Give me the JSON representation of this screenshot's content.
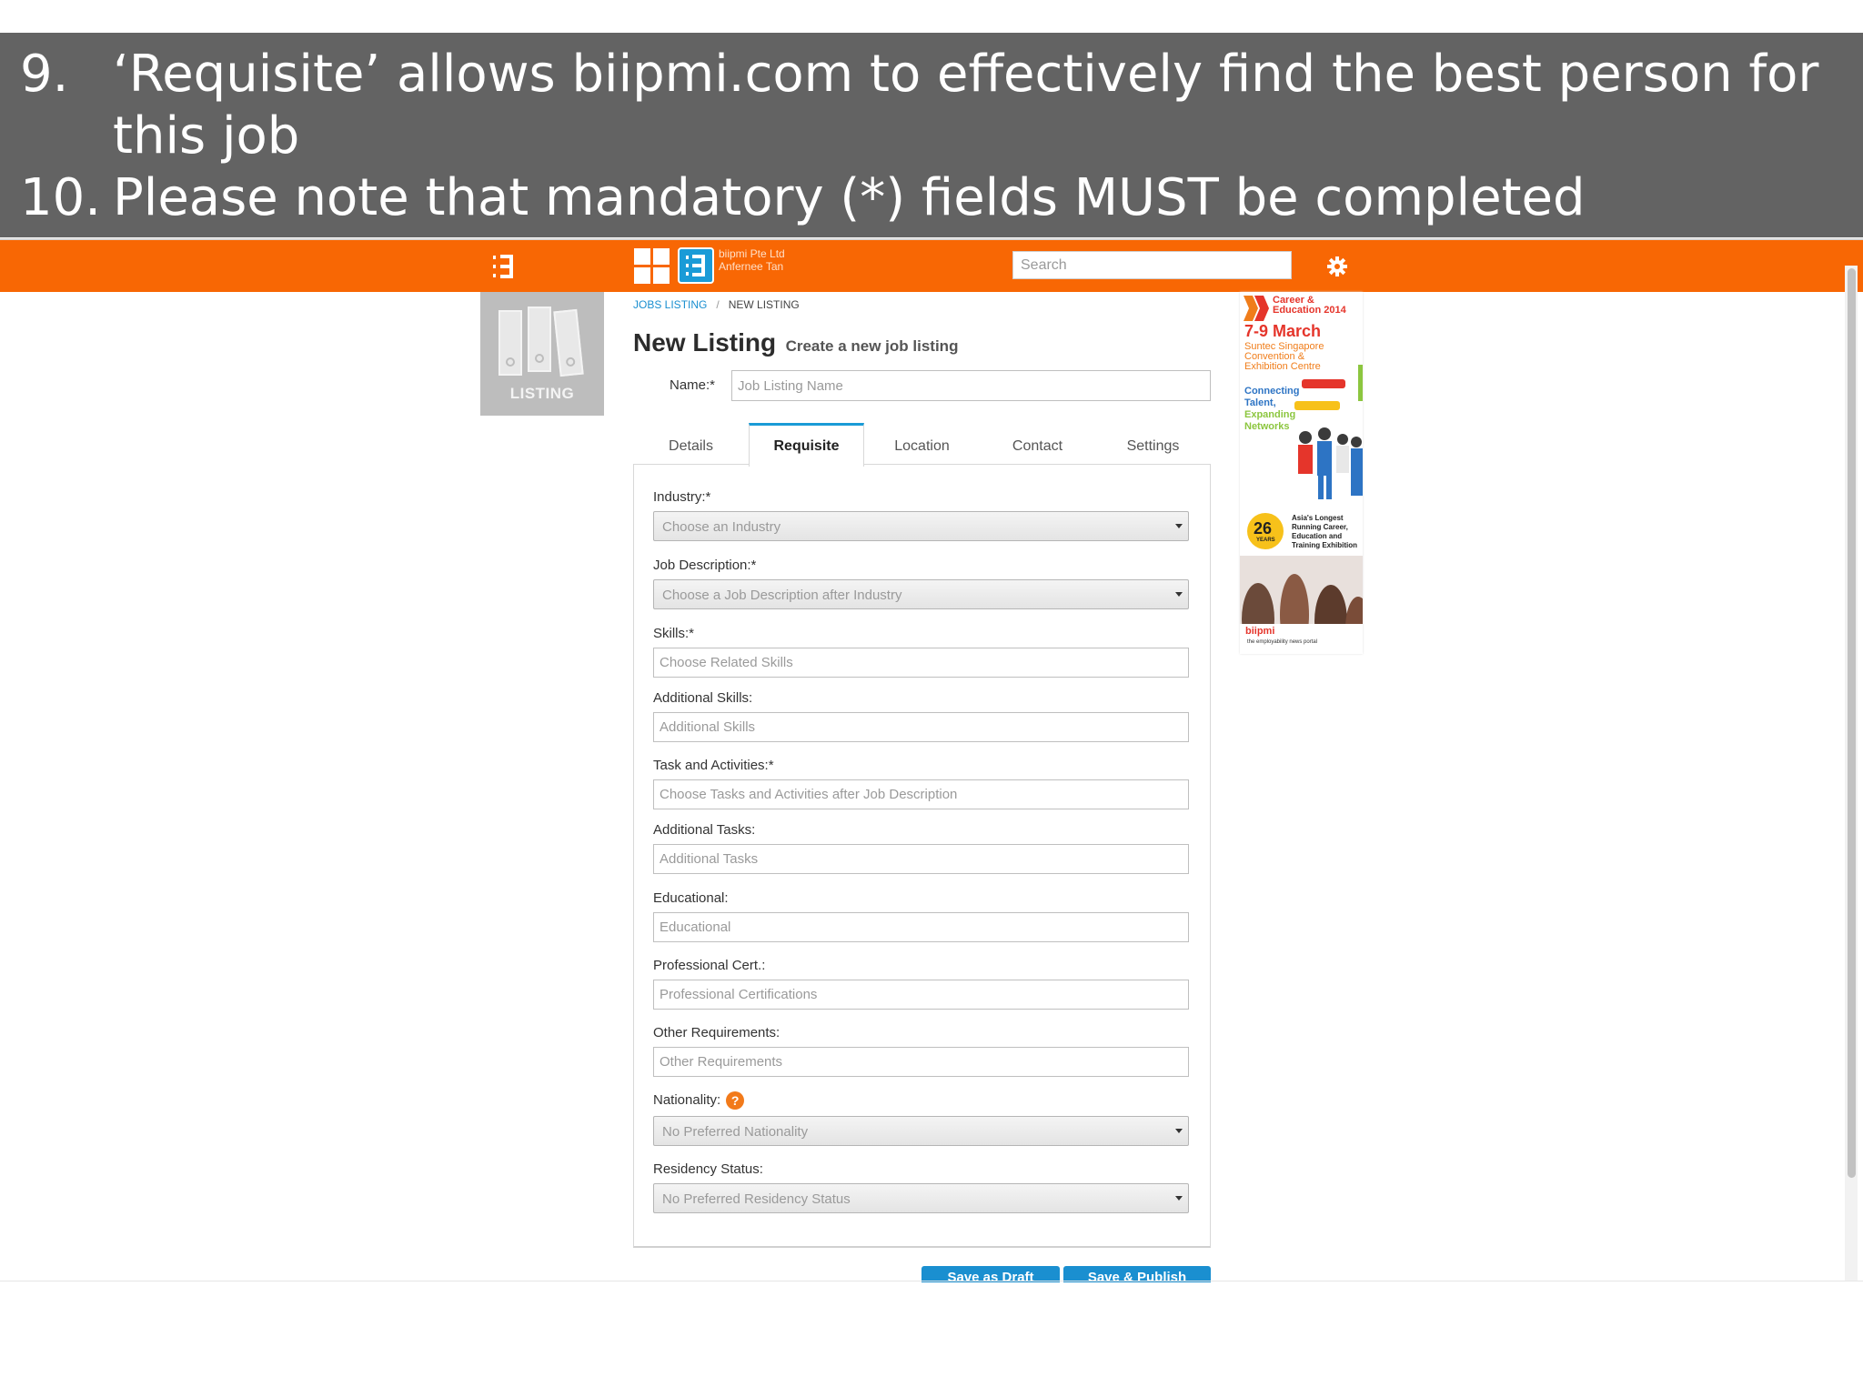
{
  "slide": {
    "item9_number": "9.",
    "item9_line1": "‘Requisite’ allows biipmi.com to effectively find the best person for",
    "item9_line2": "this job",
    "item10_number": "10.",
    "item10_text": "Please note that mandatory (*) fields MUST be completed"
  },
  "topbar": {
    "company_name": "biipmi Pte Ltd",
    "user_name": "Anfernee Tan",
    "search_placeholder": "Search",
    "icons": [
      "menu-icon",
      "apps-grid-icon",
      "brand-logo-icon",
      "gear-icon"
    ],
    "accent_color": "#f86704"
  },
  "sidebar": {
    "tile_label": "LISTING"
  },
  "breadcrumb": {
    "link": "JOBS LISTING",
    "separator": "/",
    "current": "NEW LISTING"
  },
  "header": {
    "title": "New Listing",
    "subtitle": "Create a new job listing"
  },
  "name_field": {
    "label": "Name:*",
    "placeholder": "Job Listing Name"
  },
  "tabs": [
    {
      "label": "Details",
      "active": false
    },
    {
      "label": "Requisite",
      "active": true
    },
    {
      "label": "Location",
      "active": false
    },
    {
      "label": "Contact",
      "active": false
    },
    {
      "label": "Settings",
      "active": false
    }
  ],
  "form": {
    "industry": {
      "label": "Industry:*",
      "value": "Choose an Industry"
    },
    "job_description": {
      "label": "Job Description:*",
      "value": "Choose a Job Description after Industry"
    },
    "skills": {
      "label": "Skills:*",
      "placeholder": "Choose Related Skills"
    },
    "additional_skills": {
      "label": "Additional Skills:",
      "placeholder": "Additional Skills"
    },
    "tasks": {
      "label": "Task and Activities:*",
      "placeholder": "Choose Tasks and Activities after Job Description"
    },
    "additional_tasks": {
      "label": "Additional Tasks:",
      "placeholder": "Additional Tasks"
    },
    "educational": {
      "label": "Educational:",
      "placeholder": "Educational"
    },
    "professional_cert": {
      "label": "Professional Cert.:",
      "placeholder": "Professional Certifications"
    },
    "other_requirements": {
      "label": "Other Requirements:",
      "placeholder": "Other Requirements"
    },
    "nationality": {
      "label": "Nationality:",
      "help": "?",
      "value": "No Preferred Nationality"
    },
    "residency": {
      "label": "Residency Status:",
      "value": "No Preferred Residency Status"
    }
  },
  "buttons": {
    "save_draft": "Save as Draft",
    "save_publish": "Save & Publish"
  },
  "ad": {
    "title_line1": "Career &",
    "title_line2": "Education 2014",
    "date": "7-9 March",
    "venue_line1": "Suntec Singapore",
    "venue_line2": "Convention &",
    "venue_line3": "Exhibition Centre",
    "tag_line1": "Connecting",
    "tag_line2": "Talent,",
    "tag_line3": "Expanding",
    "tag_line4": "Networks",
    "years": "26",
    "years_label": "YEARS",
    "longest_line1": "Asia's Longest",
    "longest_line2": "Running Career,",
    "longest_line3": "Education and",
    "longest_line4": "Training Exhibition",
    "portal": "biipmi",
    "portal_tag": "the employability news portal"
  }
}
